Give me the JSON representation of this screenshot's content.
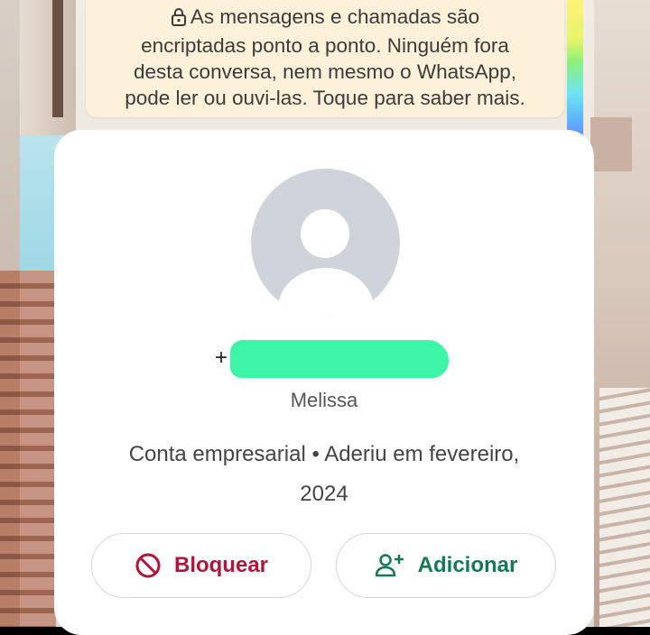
{
  "encryption_notice": {
    "lines": [
      "As mensagens e chamadas são",
      "encriptadas ponto a ponto. Ninguém fora",
      "desta conversa, nem mesmo o WhatsApp,",
      "pode ler ou ouvi-las. Toque para saber mais."
    ],
    "icon": "lock-icon"
  },
  "profile": {
    "phone_prefix": "+",
    "phone_number_redacted": true,
    "name": "Melissa",
    "business_line1": "Conta empresarial • Aderiu em fevereiro,",
    "business_line2": "2024"
  },
  "actions": {
    "block_label": "Bloquear",
    "block_icon": "block-icon",
    "add_label": "Adicionar",
    "add_icon": "add-contact-icon"
  },
  "colors": {
    "banner_bg": "#fdf1d9",
    "block_red": "#b0163c",
    "add_green": "#137a53",
    "redaction": "#3cf5a6"
  }
}
